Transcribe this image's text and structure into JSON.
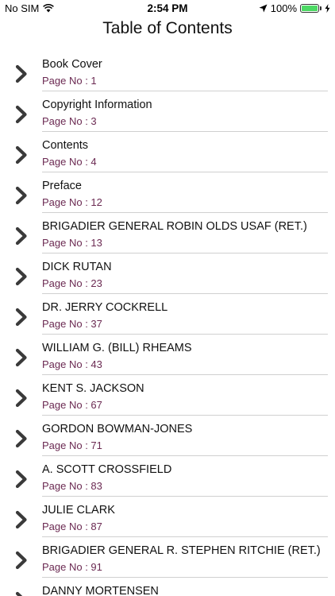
{
  "status_bar": {
    "carrier": "No SIM",
    "time": "2:54 PM",
    "battery_percent": "100%",
    "battery_level": 1.0,
    "battery_color": "#4cd964"
  },
  "nav": {
    "title": "Table of Contents"
  },
  "toc": {
    "items": [
      {
        "title": "Book Cover",
        "page": "Page No : 1"
      },
      {
        "title": "Copyright Information",
        "page": "Page No : 3"
      },
      {
        "title": "Contents",
        "page": "Page No : 4"
      },
      {
        "title": "Preface",
        "page": "Page No : 12"
      },
      {
        "title": "BRIGADIER GENERAL ROBIN OLDS USAF (RET.)",
        "page": "Page No : 13"
      },
      {
        "title": "DICK RUTAN",
        "page": "Page No : 23"
      },
      {
        "title": "DR. JERRY COCKRELL",
        "page": "Page No : 37"
      },
      {
        "title": "WILLIAM G. (BILL) RHEAMS",
        "page": "Page No : 43"
      },
      {
        "title": "KENT S. JACKSON",
        "page": "Page No : 67"
      },
      {
        "title": "GORDON BOWMAN-JONES",
        "page": "Page No : 71"
      },
      {
        "title": "A. SCOTT CROSSFIELD",
        "page": "Page No : 83"
      },
      {
        "title": "JULIE CLARK",
        "page": "Page No : 87"
      },
      {
        "title": "BRIGADIER GENERAL R. STEPHEN RITCHIE (RET.)",
        "page": "Page No : 91"
      },
      {
        "title": "DANNY MORTENSEN",
        "page": ""
      }
    ],
    "page_color": "#6b2a52"
  }
}
